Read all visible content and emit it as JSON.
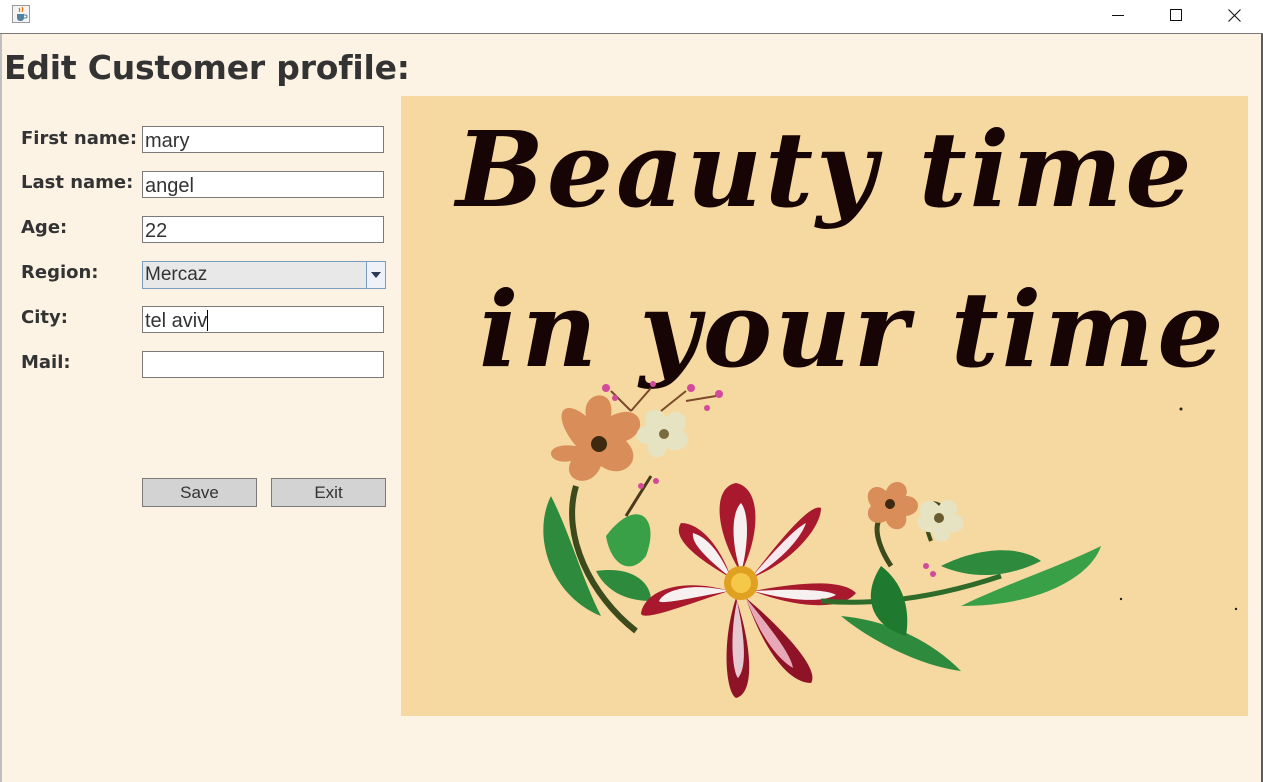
{
  "window": {
    "icon": "java-coffee-cup-icon",
    "controls": {
      "minimize": "minimize-icon",
      "maximize": "maximize-icon",
      "close": "close-icon"
    }
  },
  "form": {
    "heading": "Edit Customer profile:",
    "fields": [
      {
        "label": "First name:",
        "value": "mary"
      },
      {
        "label": "Last name:",
        "value": "angel"
      },
      {
        "label": "Age:",
        "value": "22"
      },
      {
        "label": "Region:",
        "value": "Mercaz"
      },
      {
        "label": "City:",
        "value": "tel aviv"
      },
      {
        "label": "Mail:",
        "value": ""
      }
    ],
    "save_label": "Save",
    "exit_label": "Exit"
  },
  "banner": {
    "line1": "Beauty time",
    "line2": "in your time"
  },
  "colors": {
    "background": "#fcf3e5",
    "banner": "#f5d9a0",
    "banner_text": "#170404",
    "button": "#d3d3d3"
  }
}
